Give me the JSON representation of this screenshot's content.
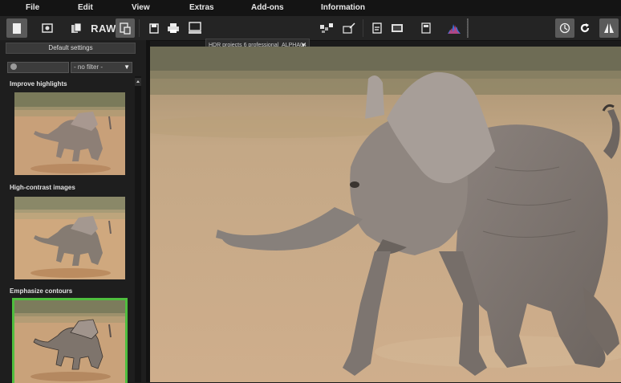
{
  "menu": [
    "File",
    "Edit",
    "View",
    "Extras",
    "Add-ons",
    "Information"
  ],
  "toolbar": {
    "raw_label": "RAW",
    "preset_value": "HDR projects 6 professional_ALPHA04"
  },
  "sidebar": {
    "default_settings": "Default settings",
    "filter_value": "- no filter -",
    "presets": [
      {
        "title": "Improve highlights"
      },
      {
        "title": "High-contrast images"
      },
      {
        "title": "Emphasize contours"
      }
    ]
  },
  "colors": {
    "accent": "#4fbe3e",
    "background": "#1a1a1a"
  }
}
